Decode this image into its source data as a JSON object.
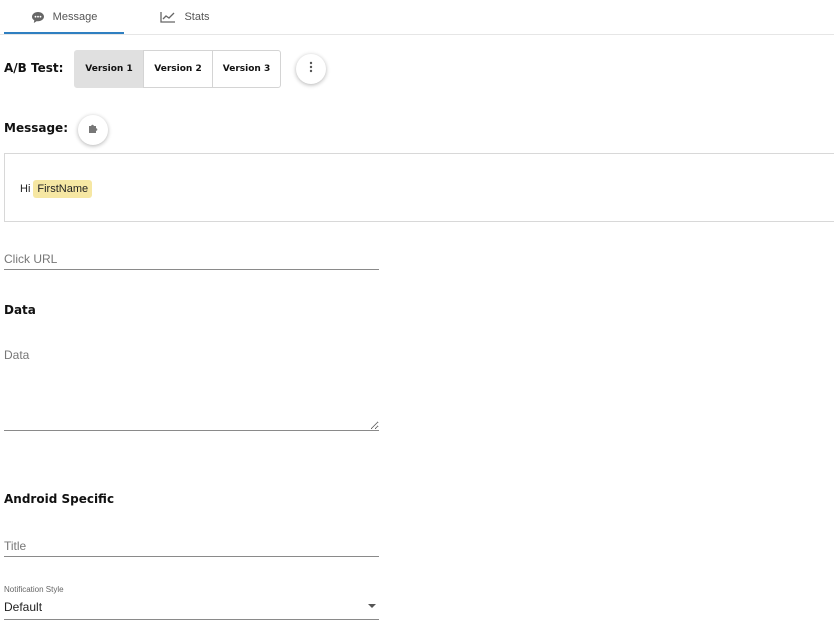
{
  "tabs": [
    {
      "label": "Message",
      "icon": "chat-bubble-icon",
      "active": true
    },
    {
      "label": "Stats",
      "icon": "line-chart-icon",
      "active": false
    }
  ],
  "ab_test": {
    "label": "A/B Test:",
    "versions": [
      "Version 1",
      "Version 2",
      "Version 3"
    ],
    "selected": "Version 1",
    "more_icon": "more-vert-icon"
  },
  "message": {
    "label": "Message:",
    "insert_icon": "puzzle-icon",
    "text": "Hi",
    "token": "FirstName"
  },
  "click_url": {
    "placeholder": "Click URL",
    "value": ""
  },
  "data_section": {
    "title": "Data",
    "placeholder": "Data",
    "value": ""
  },
  "android": {
    "title": "Android Specific",
    "title_field": {
      "placeholder": "Title",
      "value": ""
    },
    "notification_style": {
      "label": "Notification Style",
      "value": "Default"
    }
  },
  "colors": {
    "accent": "#2f7fc1",
    "token_bg": "#f6e7a3",
    "selected_version_bg": "#e0e0e0"
  }
}
